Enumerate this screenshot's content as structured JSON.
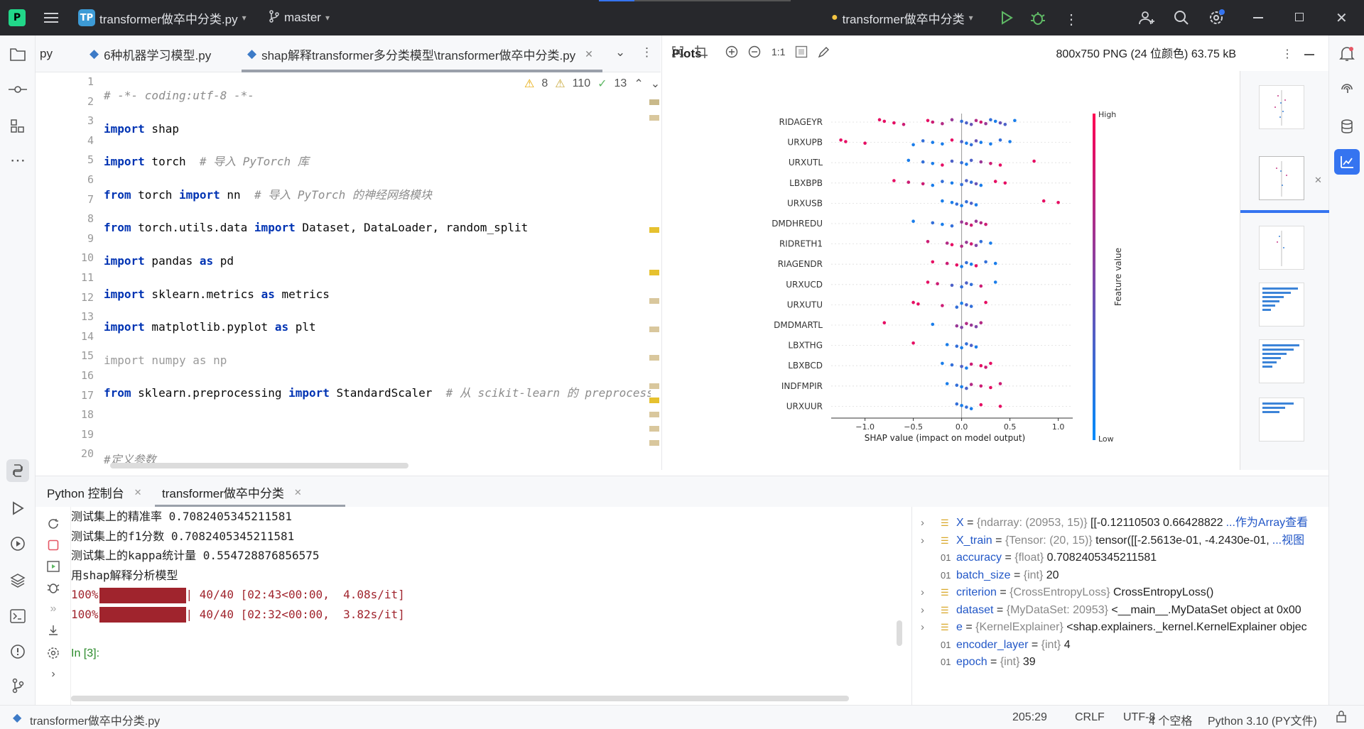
{
  "titlebar": {
    "project_badge": "TP",
    "project_name": "transformer做卒中分类.py",
    "branch": "master",
    "run_config": "transformer做卒中分类"
  },
  "editor": {
    "tabs": [
      {
        "label": "py"
      },
      {
        "label": "6种机器学习模型.py"
      },
      {
        "label": "shap解释transformer多分类模型\\transformer做卒中分类.py"
      }
    ],
    "inspections": {
      "warnings": "8",
      "weak_warnings": "110",
      "ok": "13"
    },
    "line_numbers": [
      "1",
      "2",
      "3",
      "4",
      "5",
      "6",
      "7",
      "8",
      "9",
      "10",
      "11",
      "12",
      "13",
      "14",
      "15",
      "16",
      "17",
      "18",
      "19",
      "20"
    ]
  },
  "plots": {
    "title": "Plots",
    "zoom_label": "1:1",
    "image_info": "800x750 PNG (24 位颜色) 63.75 kB"
  },
  "chart_data": {
    "type": "scatter",
    "xlabel": "SHAP value (impact on model output)",
    "xticks": [
      "−1.0",
      "−0.5",
      "0.0",
      "0.5",
      "1.0"
    ],
    "xlim": [
      -1.35,
      1.15
    ],
    "colorbar": {
      "label": "Feature value",
      "high": "High",
      "low": "Low",
      "high_color": "#ff0052",
      "low_color": "#008bfb"
    },
    "features": [
      {
        "name": "RIDAGEYR",
        "points": [
          [
            -0.85,
            0.9
          ],
          [
            -0.8,
            0.9
          ],
          [
            -0.7,
            0.9
          ],
          [
            -0.6,
            0.8
          ],
          [
            -0.35,
            0.9
          ],
          [
            -0.3,
            0.8
          ],
          [
            -0.2,
            0.7
          ],
          [
            -0.1,
            0.6
          ],
          [
            0.0,
            0.2
          ],
          [
            0.05,
            0.3
          ],
          [
            0.1,
            0.4
          ],
          [
            0.15,
            0.7
          ],
          [
            0.2,
            0.8
          ],
          [
            0.25,
            0.6
          ],
          [
            0.3,
            0.2
          ],
          [
            0.35,
            0.1
          ],
          [
            0.4,
            0.4
          ],
          [
            0.45,
            0.3
          ],
          [
            0.55,
            0.1
          ]
        ]
      },
      {
        "name": "URXUPB",
        "points": [
          [
            -1.25,
            0.9
          ],
          [
            -1.2,
            0.9
          ],
          [
            -1.0,
            0.9
          ],
          [
            -0.5,
            0.1
          ],
          [
            -0.4,
            0.2
          ],
          [
            -0.3,
            0.1
          ],
          [
            -0.2,
            0.1
          ],
          [
            -0.1,
            0.9
          ],
          [
            0.0,
            0.3
          ],
          [
            0.05,
            0.1
          ],
          [
            0.1,
            0.2
          ],
          [
            0.15,
            0.4
          ],
          [
            0.2,
            0.1
          ],
          [
            0.3,
            0.1
          ],
          [
            0.4,
            0.2
          ],
          [
            0.5,
            0.1
          ]
        ]
      },
      {
        "name": "URXUTL",
        "points": [
          [
            -0.55,
            0.1
          ],
          [
            -0.4,
            0.2
          ],
          [
            -0.3,
            0.1
          ],
          [
            -0.2,
            0.9
          ],
          [
            -0.1,
            0.3
          ],
          [
            0.0,
            0.2
          ],
          [
            0.05,
            0.1
          ],
          [
            0.1,
            0.3
          ],
          [
            0.2,
            0.6
          ],
          [
            0.3,
            0.8
          ],
          [
            0.4,
            0.9
          ],
          [
            0.75,
            0.9
          ]
        ]
      },
      {
        "name": "LBXBPB",
        "points": [
          [
            -0.7,
            0.9
          ],
          [
            -0.55,
            0.8
          ],
          [
            -0.4,
            0.8
          ],
          [
            -0.3,
            0.1
          ],
          [
            -0.2,
            0.2
          ],
          [
            -0.1,
            0.1
          ],
          [
            0.0,
            0.2
          ],
          [
            0.05,
            0.3
          ],
          [
            0.1,
            0.2
          ],
          [
            0.15,
            0.4
          ],
          [
            0.2,
            0.1
          ],
          [
            0.35,
            0.9
          ],
          [
            0.45,
            0.9
          ]
        ]
      },
      {
        "name": "URXUSB",
        "points": [
          [
            -0.2,
            0.1
          ],
          [
            -0.1,
            0.1
          ],
          [
            -0.05,
            0.2
          ],
          [
            0.0,
            0.1
          ],
          [
            0.05,
            0.2
          ],
          [
            0.1,
            0.3
          ],
          [
            0.15,
            0.1
          ],
          [
            0.85,
            0.9
          ],
          [
            1.0,
            0.9
          ]
        ]
      },
      {
        "name": "DMDHREDU",
        "points": [
          [
            -0.5,
            0.1
          ],
          [
            -0.3,
            0.2
          ],
          [
            -0.2,
            0.1
          ],
          [
            -0.1,
            0.2
          ],
          [
            0.0,
            0.6
          ],
          [
            0.05,
            0.7
          ],
          [
            0.1,
            0.8
          ],
          [
            0.15,
            0.6
          ],
          [
            0.2,
            0.7
          ],
          [
            0.25,
            0.8
          ]
        ]
      },
      {
        "name": "RIDRETH1",
        "points": [
          [
            -0.35,
            0.8
          ],
          [
            -0.15,
            0.7
          ],
          [
            -0.1,
            0.9
          ],
          [
            0.0,
            0.7
          ],
          [
            0.05,
            0.6
          ],
          [
            0.1,
            0.8
          ],
          [
            0.15,
            0.5
          ],
          [
            0.2,
            0.2
          ],
          [
            0.3,
            0.1
          ]
        ]
      },
      {
        "name": "RIAGENDR",
        "points": [
          [
            -0.3,
            0.9
          ],
          [
            -0.15,
            0.8
          ],
          [
            -0.05,
            0.9
          ],
          [
            0.0,
            0.1
          ],
          [
            0.05,
            0.2
          ],
          [
            0.1,
            0.1
          ],
          [
            0.15,
            0.9
          ],
          [
            0.25,
            0.2
          ],
          [
            0.35,
            0.1
          ]
        ]
      },
      {
        "name": "URXUCD",
        "points": [
          [
            -0.35,
            0.9
          ],
          [
            -0.25,
            0.8
          ],
          [
            -0.1,
            0.3
          ],
          [
            0.0,
            0.2
          ],
          [
            0.05,
            0.3
          ],
          [
            0.1,
            0.2
          ],
          [
            0.2,
            0.8
          ],
          [
            0.35,
            0.1
          ]
        ]
      },
      {
        "name": "URXUTU",
        "points": [
          [
            -0.5,
            0.9
          ],
          [
            -0.45,
            0.9
          ],
          [
            -0.2,
            0.8
          ],
          [
            -0.05,
            0.2
          ],
          [
            0.0,
            0.1
          ],
          [
            0.05,
            0.3
          ],
          [
            0.1,
            0.2
          ],
          [
            0.25,
            0.9
          ]
        ]
      },
      {
        "name": "DMDMARTL",
        "points": [
          [
            -0.8,
            0.9
          ],
          [
            -0.3,
            0.1
          ],
          [
            -0.05,
            0.6
          ],
          [
            0.0,
            0.5
          ],
          [
            0.05,
            0.7
          ],
          [
            0.1,
            0.6
          ],
          [
            0.15,
            0.5
          ],
          [
            0.2,
            0.7
          ]
        ]
      },
      {
        "name": "LBXTHG",
        "points": [
          [
            -0.5,
            0.9
          ],
          [
            -0.15,
            0.1
          ],
          [
            -0.05,
            0.2
          ],
          [
            0.0,
            0.1
          ],
          [
            0.05,
            0.2
          ],
          [
            0.1,
            0.3
          ],
          [
            0.15,
            0.1
          ]
        ]
      },
      {
        "name": "LBXBCD",
        "points": [
          [
            -0.2,
            0.1
          ],
          [
            -0.1,
            0.2
          ],
          [
            0.0,
            0.3
          ],
          [
            0.05,
            0.1
          ],
          [
            0.1,
            0.8
          ],
          [
            0.2,
            0.9
          ],
          [
            0.25,
            0.8
          ],
          [
            0.3,
            0.9
          ]
        ]
      },
      {
        "name": "INDFMPIR",
        "points": [
          [
            -0.15,
            0.1
          ],
          [
            -0.05,
            0.2
          ],
          [
            0.0,
            0.1
          ],
          [
            0.05,
            0.3
          ],
          [
            0.1,
            0.7
          ],
          [
            0.2,
            0.8
          ],
          [
            0.3,
            0.9
          ],
          [
            0.4,
            0.8
          ]
        ]
      },
      {
        "name": "URXUUR",
        "points": [
          [
            -0.05,
            0.2
          ],
          [
            0.0,
            0.1
          ],
          [
            0.05,
            0.2
          ],
          [
            0.1,
            0.1
          ],
          [
            0.2,
            0.9
          ],
          [
            0.4,
            0.9
          ]
        ]
      }
    ]
  },
  "bottom": {
    "tabs": [
      {
        "label": "Python 控制台"
      },
      {
        "label": "transformer做卒中分类"
      }
    ],
    "console_lines": [
      "测试集上的精准率 0.7082405345211581",
      "测试集上的f1分数 0.7082405345211581",
      "测试集上的kappa统计量 0.554728876856575",
      "用shap解释分析模型"
    ],
    "progress": [
      {
        "percent": "100%",
        "rest": "| 40/40 [02:43<00:00,  4.08s/it]",
        "fraction": 1.0
      },
      {
        "percent": "100%",
        "rest": "| 40/40 [02:32<00:00,  3.82s/it]",
        "fraction": 1.0
      }
    ],
    "prompt": "In [3]:"
  },
  "variables": [
    {
      "name": "X",
      "type": "{ndarray: (20953, 15)}",
      "value": "[[-0.12110503  0.66428822",
      "link": "...作为Array查看",
      "expandable": true,
      "icon": "array"
    },
    {
      "name": "X_train",
      "type": "{Tensor: (20, 15)}",
      "value": "tensor([[-2.5613e-01, -4.2430e-01,",
      "link": "...视图",
      "expandable": true,
      "icon": "array"
    },
    {
      "name": "accuracy",
      "type": "{float}",
      "value": "0.7082405345211581",
      "link": "",
      "expandable": false,
      "icon": "number"
    },
    {
      "name": "batch_size",
      "type": "{int}",
      "value": "20",
      "link": "",
      "expandable": false,
      "icon": "number"
    },
    {
      "name": "criterion",
      "type": "{CrossEntropyLoss}",
      "value": "CrossEntropyLoss()",
      "link": "",
      "expandable": true,
      "icon": "array"
    },
    {
      "name": "dataset",
      "type": "{MyDataSet: 20953}",
      "value": "<__main__.MyDataSet object at 0x00",
      "link": "",
      "expandable": true,
      "icon": "array"
    },
    {
      "name": "e",
      "type": "{KernelExplainer}",
      "value": "<shap.explainers._kernel.KernelExplainer objec",
      "link": "",
      "expandable": true,
      "icon": "array"
    },
    {
      "name": "encoder_layer",
      "type": "{int}",
      "value": "4",
      "link": "",
      "expandable": false,
      "icon": "number"
    },
    {
      "name": "epoch",
      "type": "{int}",
      "value": "39",
      "link": "",
      "expandable": false,
      "icon": "number"
    }
  ],
  "statusbar": {
    "file": "transformer做卒中分类.py",
    "position": "205:29",
    "line_sep": "CRLF",
    "encoding": "UTF-8",
    "indent": "4 个空格",
    "interpreter": "Python 3.10 (PY文件)"
  }
}
